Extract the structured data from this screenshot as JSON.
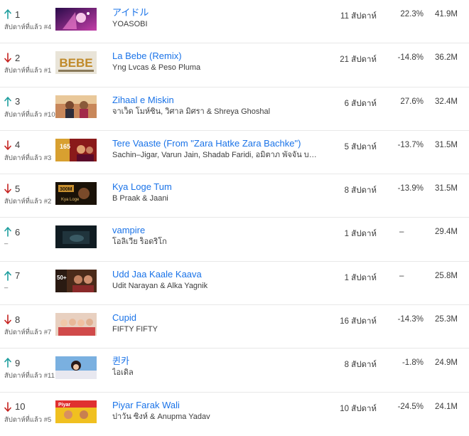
{
  "colors": {
    "up": "#1e9e9e",
    "down": "#c5221f",
    "link": "#1a73e8"
  },
  "rows": [
    {
      "trend": "up",
      "rank": "1",
      "prev": "สัปดาห์ที่แล้ว #4",
      "title": "アイドル",
      "artist": "YOASOBI",
      "weeks": "11 สัปดาห์",
      "change": "22.3%",
      "views": "41.9M",
      "thumb": "anime-purple"
    },
    {
      "trend": "down",
      "rank": "2",
      "prev": "สัปดาห์ที่แล้ว #1",
      "title": "La Bebe (Remix)",
      "artist": "Yng Lvcas & Peso Pluma",
      "weeks": "21 สัปดาห์",
      "change": "-14.8%",
      "views": "36.2M",
      "thumb": "bebe-logo"
    },
    {
      "trend": "up",
      "rank": "3",
      "prev": "สัปดาห์ที่แล้ว #10",
      "title": "Zihaal e Miskin",
      "artist": "จาเว็ด โมห์ซิน, วิศาล มิศรา & Shreya Ghoshal",
      "weeks": "6 สัปดาห์",
      "change": "27.6%",
      "views": "32.4M",
      "thumb": "couple-warm"
    },
    {
      "trend": "down",
      "rank": "4",
      "prev": "สัปดาห์ที่แล้ว #3",
      "title": "Tere Vaaste (From \"Zara Hatke Zara Bachke\")",
      "artist": "Sachin–Jigar, Varun Jain, Shadab Faridi, อมิตาภ พัจจัน บ…",
      "weeks": "5 สัปดาห์",
      "change": "-13.7%",
      "views": "31.5M",
      "thumb": "movie-red"
    },
    {
      "trend": "down",
      "rank": "5",
      "prev": "สัปดาห์ที่แล้ว #2",
      "title": "Kya Loge Tum",
      "artist": "B Praak & Jaani",
      "weeks": "8 สัปดาห์",
      "change": "-13.9%",
      "views": "31.5M",
      "thumb": "dark-gold"
    },
    {
      "trend": "up",
      "rank": "6",
      "prev": "–",
      "title": "vampire",
      "artist": "โอลิเวีย ร็อดริโก",
      "weeks": "1 สัปดาห์",
      "change": "–",
      "views": "29.4M",
      "thumb": "dark-teal"
    },
    {
      "trend": "up",
      "rank": "7",
      "prev": "–",
      "title": "Udd Jaa Kaale Kaava",
      "artist": "Udit Narayan & Alka Yagnik",
      "weeks": "1 สัปดาห์",
      "change": "–",
      "views": "25.8M",
      "thumb": "fifty-plus"
    },
    {
      "trend": "down",
      "rank": "8",
      "prev": "สัปดาห์ที่แล้ว #7",
      "title": "Cupid",
      "artist": "FIFTY FIFTY",
      "weeks": "16 สัปดาห์",
      "change": "-14.3%",
      "views": "25.3M",
      "thumb": "group-pink"
    },
    {
      "trend": "up",
      "rank": "9",
      "prev": "สัปดาห์ที่แล้ว #11",
      "title": "퀸카",
      "artist": "ไอเดิล",
      "weeks": "8 สัปดาห์",
      "change": "-1.8%",
      "views": "24.9M",
      "thumb": "blue-sky"
    },
    {
      "trend": "down",
      "rank": "10",
      "prev": "สัปดาห์ที่แล้ว #5",
      "title": "Piyar Farak Wali",
      "artist": "ปาวัน ซิงห์ & Anupma Yadav",
      "weeks": "10 สัปดาห์",
      "change": "-24.5%",
      "views": "24.1M",
      "thumb": "poster-yellow"
    }
  ]
}
